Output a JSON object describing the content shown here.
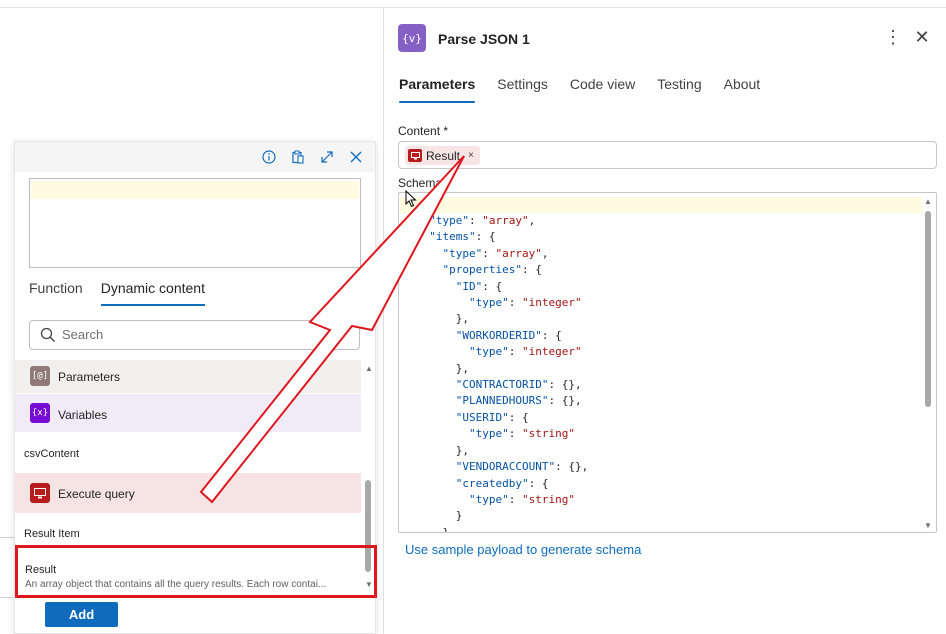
{
  "panel": {
    "icon_text": "{v}",
    "title": "Parse JSON 1",
    "more_icon": "⋮",
    "close_icon": "✕",
    "tabs": [
      "Parameters",
      "Settings",
      "Code view",
      "Testing",
      "About"
    ],
    "active_tab": "Parameters",
    "content_label": "Content *",
    "content_token": "Result",
    "token_remove": "×",
    "schema_label": "Schema *",
    "sample_link": "Use sample payload to generate schema"
  },
  "popup": {
    "tabs": [
      "Function",
      "Dynamic content"
    ],
    "active_tab": "Dynamic content",
    "search_placeholder": "Search",
    "groups": [
      {
        "label": "Parameters",
        "icon": "parameters-icon",
        "icon_text": "[@]"
      },
      {
        "label": "Variables",
        "icon": "variables-icon",
        "icon_text": "{x}"
      }
    ],
    "section_csv": "csvContent",
    "execute_query": "Execute query",
    "section_result_item": "Result Item",
    "result_title": "Result",
    "result_desc": "An array object that contains all the query results. Each row contai...",
    "add_label": "Add"
  },
  "colors": {
    "accent": "#0f6cbd",
    "action_purple": "#8661c5",
    "token_red": "#b81c1c",
    "highlight_red": "#e0161e"
  }
}
